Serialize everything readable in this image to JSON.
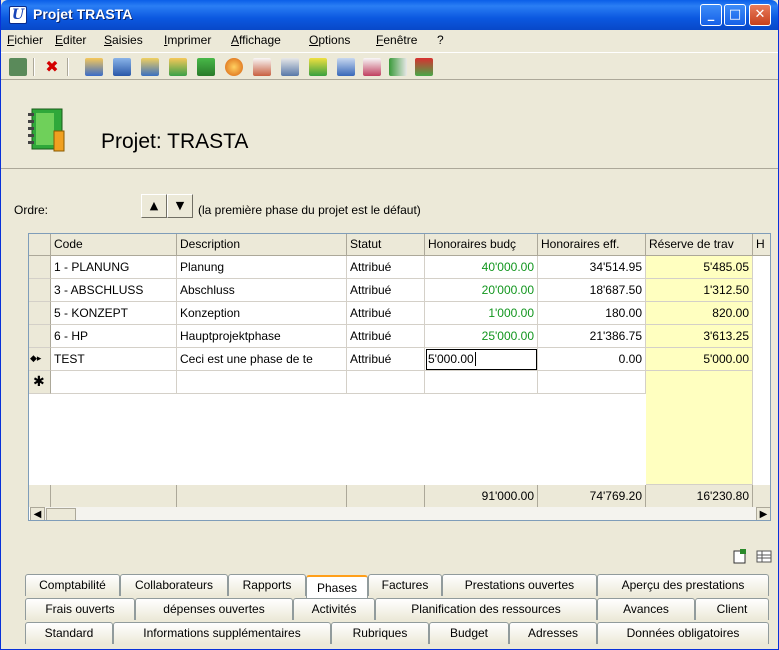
{
  "window": {
    "title": "Projet TRASTA",
    "icon_letter": "U",
    "minimize_glyph": "_",
    "maximize_glyph": "□",
    "close_glyph": "✕"
  },
  "menu": [
    "Fichier",
    "Editer",
    "Saisies",
    "Imprimer",
    "Affichage",
    "Options",
    "Fenêtre",
    "?"
  ],
  "header": {
    "title": "Projet: TRASTA"
  },
  "ordre": {
    "label": "Ordre:",
    "up_glyph": "▲",
    "down_glyph": "▼",
    "note": "(la première phase du projet est le défaut)"
  },
  "grid": {
    "columns": [
      "Code",
      "Description",
      "Statut",
      "Honoraires budç",
      "Honoraires eff.",
      "Réserve de trav",
      "H"
    ],
    "rows": [
      {
        "marker": "",
        "code": "1 - PLANUNG",
        "desc": "Planung",
        "statut": "Attribué",
        "budget": "40'000.00",
        "eff": "34'514.95",
        "reserve": "5'485.05"
      },
      {
        "marker": "",
        "code": "3 - ABSCHLUSS",
        "desc": "Abschluss",
        "statut": "Attribué",
        "budget": "20'000.00",
        "eff": "18'687.50",
        "reserve": "1'312.50"
      },
      {
        "marker": "",
        "code": "5 - KONZEPT",
        "desc": "Konzeption",
        "statut": "Attribué",
        "budget": "1'000.00",
        "eff": "180.00",
        "reserve": "820.00"
      },
      {
        "marker": "",
        "code": "6 - HP",
        "desc": "Hauptprojektphase",
        "statut": "Attribué",
        "budget": "25'000.00",
        "eff": "21'386.75",
        "reserve": "3'613.25"
      },
      {
        "marker": "◆▸",
        "code": "TEST",
        "desc": "Ceci est une phase de te",
        "statut": "Attribué",
        "budget": "5'000.00",
        "eff": "0.00",
        "reserve": "5'000.00"
      }
    ],
    "new_row_marker": "✱",
    "totals": {
      "budget": "91'000.00",
      "eff": "74'769.20",
      "reserve": "16'230.80"
    },
    "scroll_left": "◀",
    "scroll_right": "▶"
  },
  "tabs": {
    "row1": [
      "Comptabilité",
      "Collaborateurs",
      "Rapports",
      "Phases",
      "Factures",
      "Prestations ouvertes",
      "Aperçu des prestations"
    ],
    "row2": [
      "Frais ouverts",
      "dépenses ouvertes",
      "Activités",
      "Planification des ressources",
      "Avances",
      "Client"
    ],
    "row3": [
      "Standard",
      "Informations supplémentaires",
      "Rubriques",
      "Budget",
      "Adresses",
      "Données obligatoires"
    ],
    "active": "Phases"
  },
  "colors": {
    "accent": "#0a5ee8",
    "positive": "#12961e",
    "highlight": "#ffffc0"
  },
  "toolbar_icons": [
    "tree-icon",
    "delete-icon",
    "person-icon",
    "building-icon",
    "buildings-icon",
    "person-icon",
    "notebook-icon",
    "clock-icon",
    "notepad-icon",
    "document-icon",
    "brush-icon",
    "card-icon",
    "mail-icon",
    "arrow-in-icon",
    "export-icon"
  ]
}
